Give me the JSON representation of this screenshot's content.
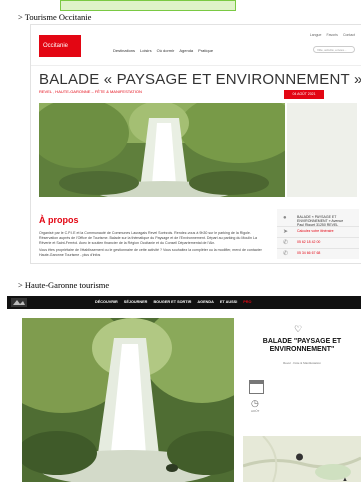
{
  "section1": {
    "label": "> Tourisme Occitanie",
    "logo": "Occitanie",
    "nav": [
      "Destinations",
      "Loisirs",
      "Où dormir",
      "Agenda",
      "Pratique"
    ],
    "util": [
      "Langue",
      "Favoris",
      "Contact"
    ],
    "search_placeholder": "Ville, activité, envies...",
    "title": "BALADE « PAYSAGE ET ENVIRONNEMENT »",
    "subtitle": "REVEL , HAUTE-GARONNE – FÊTE & MANIFESTATION",
    "date_badge": "04 AOÛT 2021",
    "apropos_title": "À propos",
    "description": "Organisé par le C.P.I.E et la Communauté de Communes Lauragais Revel Sorèzois. Rendez-vous à 9h30 sur le parking de la Rigole. Réservation auprès de l'Office de Tourisme. Balade sur la thématique du Paysage et de l'Environnement. Départ au parking du Moulin La Rêverie et Saint-Ferréol. Avec le soutien financier de la Région Occitanie et du Conseil Départemental de l'Ain.",
    "description_more": "Vous êtes propriétaire de l'établissement ou le gestionnaire de cette activité ? Vous souhaitez la compléter ou la modifier, merci de contacter Haute-Garonne Tourisme - plus d'infos",
    "info": [
      {
        "icon": "location-pin-icon",
        "text": "BALADE « PAYSAGE ET ENVIRONNEMENT » Avenue Paul Riquet 31250 REVEL"
      },
      {
        "icon": "directions-icon",
        "text": "Calculez votre itinéraire"
      },
      {
        "icon": "phone-icon",
        "text": "05 62 18 42 00"
      },
      {
        "icon": "phone-icon",
        "text": "05 34 66 67 68"
      }
    ]
  },
  "section2": {
    "label": "> Haute-Garonne tourisme",
    "nav": [
      "DÉCOUVRIR",
      "SÉJOURNER",
      "BOUGER ET SORTIR",
      "AGENDA",
      "ET AUSSI",
      "PRO"
    ],
    "title": "BALADE \"PAYSAGE ET ENVIRONNEMENT\"",
    "subtitle": "Revel · Fête & Manifestation",
    "clock_label": "AOÛT"
  },
  "colors": {
    "brand_red": "#e30613",
    "nav_dark": "#111111",
    "highlight_green": "#7ac943"
  }
}
